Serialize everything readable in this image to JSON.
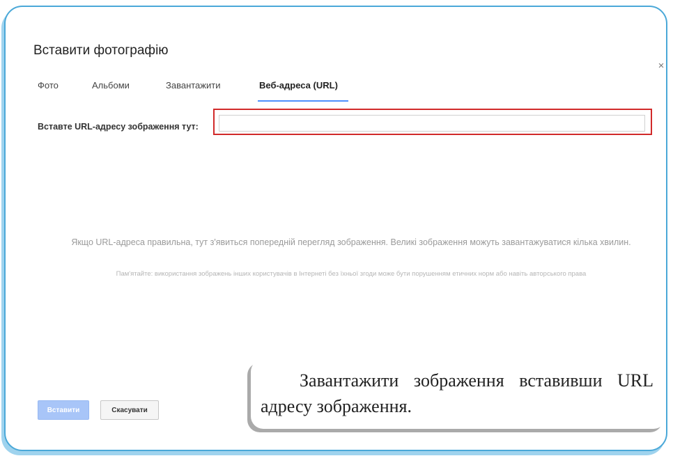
{
  "dialog": {
    "title": "Вставити фотографію",
    "close_icon": "×"
  },
  "tabs": [
    {
      "label": "Фото",
      "active": false
    },
    {
      "label": "Альбоми",
      "active": false
    },
    {
      "label": "Завантажити",
      "active": false
    },
    {
      "label": "Веб-адреса (URL)",
      "active": true
    }
  ],
  "url_field": {
    "label": "Вставте URL-адресу зображення тут:",
    "value": "",
    "placeholder": ""
  },
  "preview": {
    "message": "Якщо URL-адреса правильна, тут з'явиться попередній перегляд зображення. Великі зображення можуть завантажуватися кілька хвилин.",
    "warning": "Пам'ятайте: використання зображень інших користувачів в Інтернеті без їхньої згоди може бути порушенням етичних норм або навіть авторського права"
  },
  "buttons": {
    "insert_label": "Вставити",
    "cancel_label": "Скасувати"
  },
  "caption": {
    "text": "Завантажити зображення вставивши URL адресу зображення."
  },
  "colors": {
    "frame_border": "#4aa8d8",
    "tab_underline": "#4d90fe",
    "highlight_border": "#d12a2a",
    "insert_button": "#a8c5f8"
  }
}
